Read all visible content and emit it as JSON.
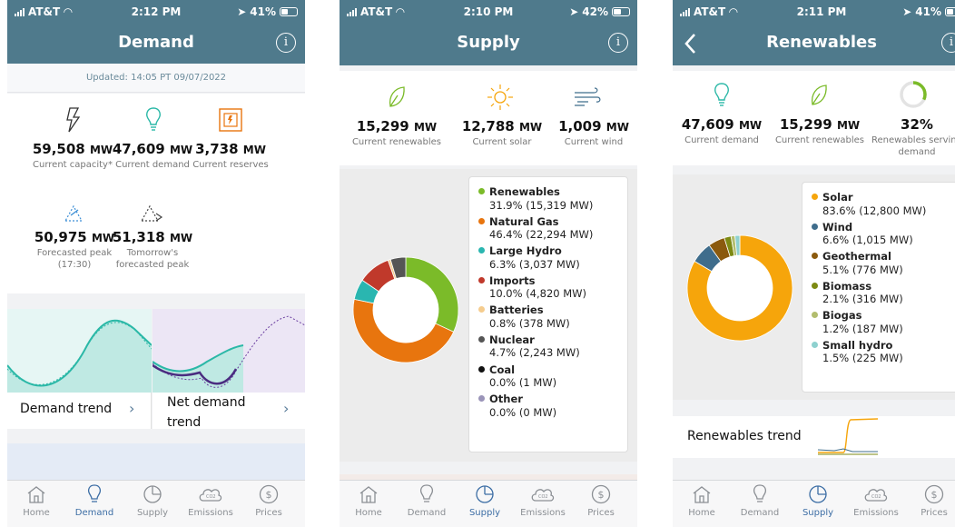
{
  "status": {
    "carrier": "AT&T",
    "s1_time": "2:12 PM",
    "s1_batt": "41%",
    "s2_time": "2:10 PM",
    "s2_batt": "42%",
    "s3_time": "2:11 PM",
    "s3_batt": "41%"
  },
  "demand": {
    "title": "Demand",
    "updated": "Updated: 14:05 PT 09/07/2022",
    "stats": [
      {
        "value": "59,508",
        "unit": "MW",
        "label": "Current capacity*"
      },
      {
        "value": "47,609",
        "unit": "MW",
        "label": "Current demand"
      },
      {
        "value": "3,738",
        "unit": "MW",
        "label": "Current reserves"
      },
      {
        "value": "50,975",
        "unit": "MW",
        "label": "Forecasted peak (17:30)"
      },
      {
        "value": "51,318",
        "unit": "MW",
        "label": "Tomorrow's forecasted peak"
      }
    ],
    "trend1": "Demand trend",
    "trend2": "Net demand trend"
  },
  "supply": {
    "title": "Supply",
    "stats": [
      {
        "value": "15,299",
        "unit": "MW",
        "label": "Current renewables"
      },
      {
        "value": "12,788",
        "unit": "MW",
        "label": "Current solar"
      },
      {
        "value": "1,009",
        "unit": "MW",
        "label": "Current wind"
      }
    ],
    "legend": [
      {
        "name": "Renewables",
        "detail": "31.9% (15,319 MW)",
        "pct": 31.9,
        "color": "#7bbb29"
      },
      {
        "name": "Natural Gas",
        "detail": "46.4% (22,294 MW)",
        "pct": 46.4,
        "color": "#e8750e"
      },
      {
        "name": "Large Hydro",
        "detail": "6.3% (3,037 MW)",
        "pct": 6.3,
        "color": "#2ab6b0"
      },
      {
        "name": "Imports",
        "detail": "10.0% (4,820 MW)",
        "pct": 10.0,
        "color": "#c0392b"
      },
      {
        "name": "Batteries",
        "detail": "0.8% (378 MW)",
        "pct": 0.8,
        "color": "#f5cc8e"
      },
      {
        "name": "Nuclear",
        "detail": "4.7% (2,243 MW)",
        "pct": 4.7,
        "color": "#555555"
      },
      {
        "name": "Coal",
        "detail": "0.0% (1 MW)",
        "pct": 0.0,
        "color": "#111111"
      },
      {
        "name": "Other",
        "detail": "0.0% (0 MW)",
        "pct": 0.0,
        "color": "#9a94b8"
      }
    ]
  },
  "renewables": {
    "title": "Renewables",
    "stats": [
      {
        "value": "47,609",
        "unit": "MW",
        "label": "Current demand"
      },
      {
        "value": "15,299",
        "unit": "MW",
        "label": "Current renewables"
      },
      {
        "value": "32%",
        "unit": "",
        "label": "Renewables serving demand"
      }
    ],
    "serving_fraction": 0.32,
    "legend": [
      {
        "name": "Solar",
        "detail": "83.6% (12,800 MW)",
        "pct": 83.6,
        "color": "#f6a50b"
      },
      {
        "name": "Wind",
        "detail": "6.6% (1,015 MW)",
        "pct": 6.6,
        "color": "#3f6d8c"
      },
      {
        "name": "Geothermal",
        "detail": "5.1% (776 MW)",
        "pct": 5.1,
        "color": "#8b5a0e"
      },
      {
        "name": "Biomass",
        "detail": "2.1% (316 MW)",
        "pct": 2.1,
        "color": "#7d8a13"
      },
      {
        "name": "Biogas",
        "detail": "1.2% (187 MW)",
        "pct": 1.2,
        "color": "#b2bd6e"
      },
      {
        "name": "Small hydro",
        "detail": "1.5% (225 MW)",
        "pct": 1.5,
        "color": "#8ed1cf"
      }
    ],
    "trend": "Renewables trend"
  },
  "tabs": [
    "Home",
    "Demand",
    "Supply",
    "Emissions",
    "Prices"
  ],
  "colors": {
    "header": "#4f7a8c",
    "active_tab": "#3d6ea5",
    "demand_teal": "#2bb8a7",
    "net_demand_purple": "#6b3fa0"
  }
}
